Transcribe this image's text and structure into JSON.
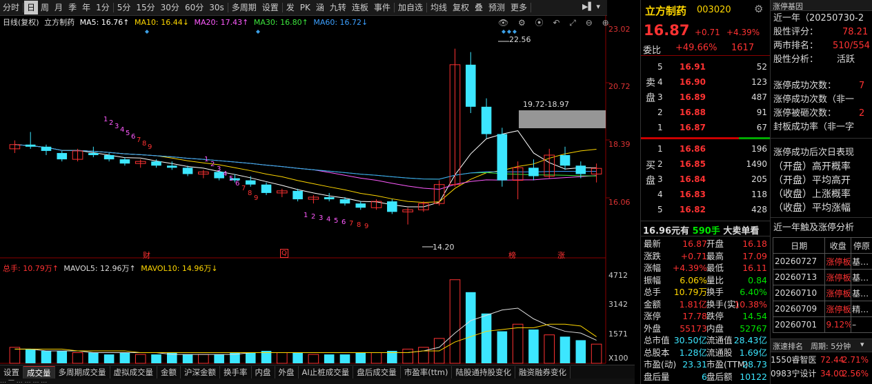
{
  "toolbar": {
    "items": [
      "分时",
      "日",
      "周",
      "月",
      "季",
      "年",
      "1分",
      "5分",
      "15分",
      "30分",
      "60分",
      "30s",
      "多周期",
      "设置",
      "发",
      "PK",
      "涵",
      "九转",
      "连板",
      "事件",
      "加自选",
      "均线",
      "复权",
      "叠",
      "预测",
      "更多"
    ]
  },
  "chart": {
    "ma_title": "日线(复权)",
    "stock": "立方制药",
    "ma5": "MA5: 16.76↑",
    "ma10": "MA10: 16.44↓",
    "ma20": "MA20: 17.43↑",
    "ma30": "MA30: 16.80↑",
    "ma60": "MA60: 16.72↓",
    "y_labels": [
      "23.02",
      "20.72",
      "18.39",
      "16.06"
    ],
    "peak_label": "22.56",
    "range_label": "19.72-18.97",
    "low_label": "14.20",
    "event_markers": [
      "财",
      "Q",
      "榜",
      "涨"
    ],
    "vol_title": "总手: 10.79万↑",
    "mavol5": "MAVOL5: 12.96万↑",
    "mavol10": "MAVOL10: 14.96万↓",
    "vol_labels": [
      "4712",
      "3142",
      "1571",
      "X100"
    ],
    "seq_top": [
      "1",
      "2",
      "3",
      "4",
      "5",
      "6",
      "7",
      "8",
      "9"
    ],
    "seq_mid": [
      "1",
      "2",
      "3",
      "4",
      "5",
      "6",
      "7",
      "8",
      "9"
    ],
    "seq_low": [
      "1",
      "2",
      "3",
      "4",
      "5",
      "6",
      "7",
      "8",
      "9"
    ]
  },
  "chart_data": {
    "type": "candlestick",
    "y_range": [
      13.5,
      23.5
    ],
    "candles": [
      [
        17.8,
        18.2,
        17.6,
        18.0
      ],
      [
        18.0,
        18.6,
        17.8,
        17.9
      ],
      [
        17.9,
        18.0,
        17.5,
        17.7
      ],
      [
        17.6,
        17.7,
        17.2,
        17.3
      ],
      [
        17.3,
        17.8,
        17.2,
        17.7
      ],
      [
        17.6,
        17.9,
        17.4,
        17.5
      ],
      [
        17.5,
        17.6,
        17.2,
        17.3
      ],
      [
        17.3,
        17.4,
        17.0,
        17.1
      ],
      [
        17.1,
        17.3,
        16.9,
        17.2
      ],
      [
        17.2,
        17.3,
        16.9,
        17.0
      ],
      [
        17.0,
        17.2,
        16.8,
        16.9
      ],
      [
        16.9,
        17.0,
        16.5,
        16.6
      ],
      [
        16.6,
        16.8,
        16.4,
        16.7
      ],
      [
        16.7,
        16.8,
        16.3,
        16.4
      ],
      [
        16.4,
        16.6,
        16.2,
        16.3
      ],
      [
        16.3,
        16.5,
        16.0,
        16.1
      ],
      [
        16.1,
        16.2,
        15.6,
        15.7
      ],
      [
        15.7,
        15.9,
        15.5,
        15.8
      ],
      [
        15.8,
        15.9,
        15.3,
        15.4
      ],
      [
        15.4,
        15.6,
        15.2,
        15.5
      ],
      [
        15.5,
        15.7,
        15.3,
        15.4
      ],
      [
        15.4,
        15.5,
        15.1,
        15.2
      ],
      [
        15.2,
        15.3,
        14.9,
        15.0
      ],
      [
        15.0,
        15.4,
        14.9,
        15.3
      ],
      [
        15.3,
        15.4,
        14.7,
        14.8
      ],
      [
        14.8,
        15.0,
        14.2,
        14.9
      ],
      [
        14.9,
        15.3,
        14.8,
        15.2
      ],
      [
        15.2,
        16.3,
        15.1,
        16.1
      ],
      [
        16.1,
        22.56,
        16.0,
        21.8
      ],
      [
        21.8,
        22.4,
        19.5,
        19.8
      ],
      [
        19.8,
        20.2,
        18.3,
        18.5
      ],
      [
        18.5,
        18.8,
        16.0,
        16.3
      ],
      [
        16.3,
        17.2,
        15.4,
        16.9
      ],
      [
        16.9,
        17.3,
        16.3,
        16.5
      ],
      [
        16.5,
        17.8,
        16.4,
        17.5
      ],
      [
        17.5,
        17.9,
        16.8,
        17.0
      ],
      [
        17.0,
        17.2,
        16.4,
        16.6
      ],
      [
        16.6,
        17.1,
        16.2,
        16.87
      ]
    ],
    "volumes": [
      9,
      8,
      7,
      7,
      6,
      6,
      5,
      6,
      5,
      5,
      6,
      5,
      5,
      5,
      6,
      6,
      7,
      6,
      6,
      5,
      5,
      5,
      6,
      6,
      7,
      8,
      9,
      14,
      47,
      40,
      28,
      18,
      22,
      19,
      16,
      15,
      13,
      10.79
    ],
    "mavol5": [
      8,
      8,
      7,
      7,
      7,
      6,
      6,
      6,
      6,
      6,
      5,
      5,
      5,
      5,
      5,
      6,
      6,
      6,
      6,
      6,
      6,
      6,
      6,
      6,
      6,
      6,
      7,
      9,
      17,
      24,
      27,
      30,
      31,
      25,
      21,
      18,
      17,
      12.96
    ],
    "mavol10": [
      8,
      8,
      8,
      8,
      7,
      7,
      7,
      7,
      6,
      6,
      6,
      6,
      6,
      6,
      6,
      6,
      6,
      6,
      6,
      6,
      6,
      6,
      6,
      6,
      6,
      6,
      7,
      7,
      12,
      15,
      18,
      19,
      20,
      20,
      22,
      22,
      21,
      14.96
    ]
  },
  "bottom": {
    "tabs": [
      "设置",
      "成交量",
      "多周期成交量",
      "虚拟成交量",
      "金额",
      "沪深金额",
      "换手率",
      "内盘",
      "外盘",
      "AI止桩成交量",
      "盘后成交量",
      "市盈率(ttm)",
      "陆股通持股变化",
      "融资融券变化"
    ],
    "status": "… 一 … … … …"
  },
  "quote": {
    "name": "立方制药",
    "code": "003020",
    "price": "16.87",
    "change": "+0.71",
    "pct": "+4.39%",
    "wb_label": "委比",
    "wb_pct": "+49.66%",
    "wb_val": "1617",
    "sell_label": "卖盘",
    "buy_label": "买盘",
    "sells": [
      {
        "lvl": "5",
        "price": "16.91",
        "vol": "52"
      },
      {
        "lvl": "4",
        "price": "16.90",
        "vol": "123"
      },
      {
        "lvl": "3",
        "price": "16.89",
        "vol": "487"
      },
      {
        "lvl": "2",
        "price": "16.88",
        "vol": "91"
      },
      {
        "lvl": "1",
        "price": "16.87",
        "vol": "67"
      }
    ],
    "buys": [
      {
        "lvl": "1",
        "price": "16.86",
        "vol": "196"
      },
      {
        "lvl": "2",
        "price": "16.85",
        "vol": "1490"
      },
      {
        "lvl": "3",
        "price": "16.84",
        "vol": "205"
      },
      {
        "lvl": "4",
        "price": "16.83",
        "vol": "118"
      },
      {
        "lvl": "5",
        "price": "16.82",
        "vol": "428"
      }
    ],
    "big_order": "16.96元有",
    "big_order_vol": "590手",
    "big_order_tail": "大卖单看",
    "stats": [
      {
        "l1": "最新",
        "v1": "16.87",
        "l2": "开盘",
        "v2": "16.18"
      },
      {
        "l1": "涨跌",
        "v1": "+0.71",
        "l2": "最高",
        "v2": "17.09"
      },
      {
        "l1": "涨幅",
        "v1": "+4.39%",
        "l2": "最低",
        "v2": "16.11"
      },
      {
        "l1": "振幅",
        "v1": "6.06%",
        "l2": "量比",
        "v2": "0.84"
      },
      {
        "l1": "总手",
        "v1": "10.79万",
        "l2": "换手",
        "v2": "6.40%"
      },
      {
        "l1": "金额",
        "v1": "1.81亿",
        "l2": "换手(实)",
        "v2": "10.38%"
      },
      {
        "l1": "涨停",
        "v1": "17.78",
        "l2": "跌停",
        "v2": "14.54"
      },
      {
        "l1": "外盘",
        "v1": "55173",
        "l2": "内盘",
        "v2": "52767"
      },
      {
        "l1": "总市值",
        "v1": "30.50亿",
        "l2": "流通值",
        "v2": "28.43亿"
      },
      {
        "l1": "总股本",
        "v1": "1.28亿",
        "l2": "流通股",
        "v2": "1.69亿"
      },
      {
        "l1": "市盈(动)",
        "v1": "23.31",
        "l2": "市盈(TTM)",
        "v2": "28.73"
      },
      {
        "l1": "盘后量",
        "v1": "6",
        "l2": "盘后额",
        "v2": "10122"
      }
    ]
  },
  "limitup": {
    "title": "涨停基因",
    "period": "近一年（20250730-2",
    "score_l": "股性评分：",
    "score_v": "78.21",
    "rank_l": "两市排名：",
    "rank_v": "510/554",
    "anal_l": "股性分析：",
    "anal_v": "活跃",
    "success_l": "涨停成功次数：",
    "success_v": "7",
    "success2_l": "涨停成功次数（非一",
    "broken_l": "涨停被砸次数：",
    "broken_v": "2",
    "seal_l": "封板成功率（非一字",
    "next_title": "涨停成功后次日表现",
    "next_items": [
      "（开盘）高开概率",
      "（开盘）平均高开",
      "（收盘）上涨概率",
      "（收盘）平均涨幅"
    ],
    "year_title": "近一年触及涨停分析",
    "table_headers": [
      "日期",
      "收盘",
      "停原"
    ],
    "rows": [
      {
        "date": "20260727",
        "close": "涨停板",
        "reason": "基…"
      },
      {
        "date": "20260713",
        "close": "涨停板",
        "reason": "基…"
      },
      {
        "date": "20260710",
        "close": "涨停板",
        "reason": "基…"
      },
      {
        "date": "20260709",
        "close": "涨停板",
        "reason": "精…"
      },
      {
        "date": "20260701",
        "close": "9.12%",
        "reason": "–"
      }
    ],
    "speed_title": "涨速排名",
    "speed_period": "周期: 5分钟",
    "speed_rows": [
      {
        "code": "1550",
        "name": "睿智医",
        "price": "72.44",
        "pct": "2.71%"
      },
      {
        "code": "0983",
        "name": "宁设计",
        "price": "34.00",
        "pct": "2.56%"
      }
    ]
  }
}
